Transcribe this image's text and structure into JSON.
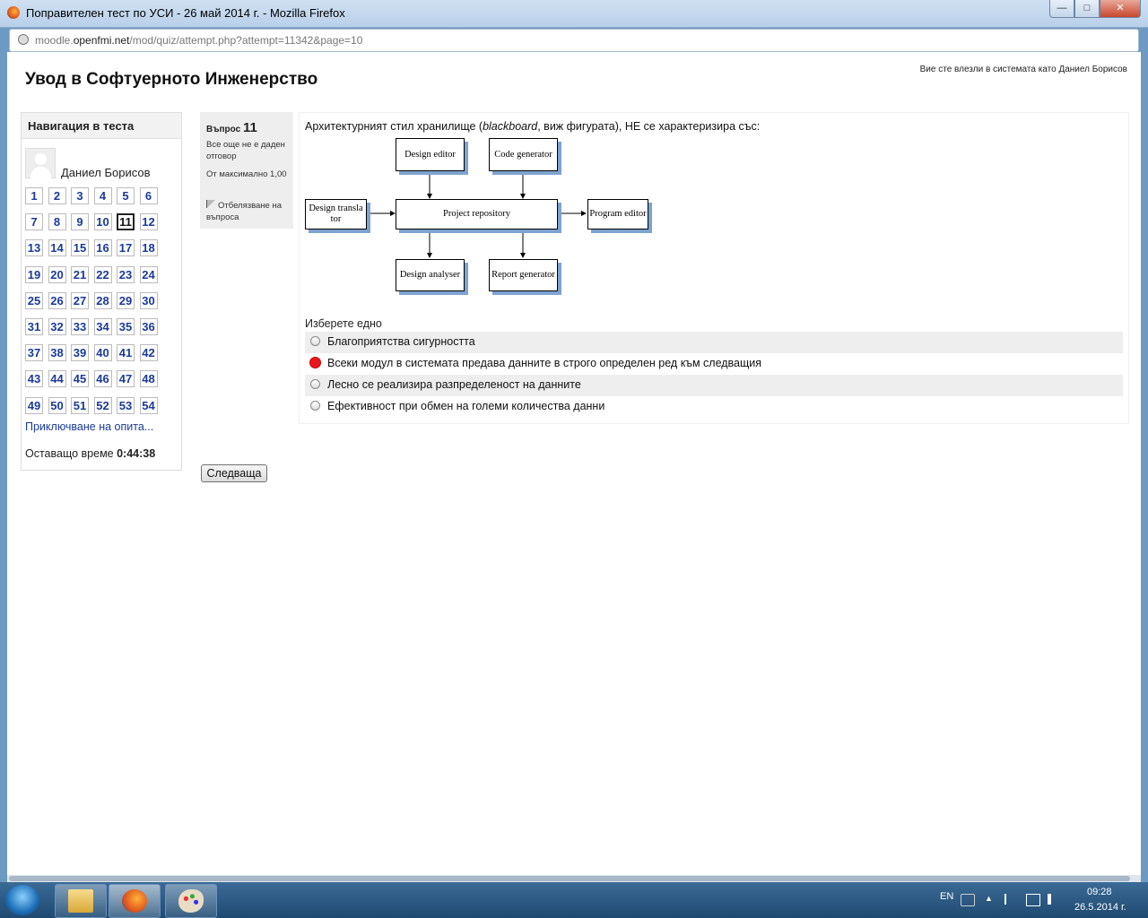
{
  "window": {
    "title": "Поправителен тест по УСИ - 26 май 2014 г. - Mozilla Firefox",
    "url_pre": "moodle.",
    "url_domain": "openfmi.net",
    "url_path": "/mod/quiz/attempt.php?attempt=11342&page=10"
  },
  "header": {
    "site_title": "Увод в Софтуерното Инженерство",
    "login_info": "Вие сте влезли в системата като Даниел Борисов"
  },
  "nav": {
    "title": "Навигация в теста",
    "user": "Даниел Борисов",
    "questions": [
      "1",
      "2",
      "3",
      "4",
      "5",
      "6",
      "7",
      "8",
      "9",
      "10",
      "11",
      "12",
      "13",
      "14",
      "15",
      "16",
      "17",
      "18",
      "19",
      "20",
      "21",
      "22",
      "23",
      "24",
      "25",
      "26",
      "27",
      "28",
      "29",
      "30",
      "31",
      "32",
      "33",
      "34",
      "35",
      "36",
      "37",
      "38",
      "39",
      "40",
      "41",
      "42",
      "43",
      "44",
      "45",
      "46",
      "47",
      "48",
      "49",
      "50",
      "51",
      "52",
      "53",
      "54"
    ],
    "current": "11",
    "finish_link": "Приключване на опита...",
    "timer_label": "Оставащо време",
    "timer_value": "0:44:38"
  },
  "question": {
    "label": "Въпрос",
    "number": "11",
    "state": "Все още не е даден отговор",
    "grade": "От максимално 1,00",
    "flag": "Отбелязване на въпроса",
    "text_before": "Архитектурният стил хранилище (",
    "text_italic": "blackboard",
    "text_after": ", виж фигурата), НЕ се характеризира със:",
    "prompt": "Изберете едно",
    "answers": [
      {
        "label": "Благоприятства сигурността",
        "checked": false
      },
      {
        "label": "Всеки модул в системата предава данните в строго определен ред към следващия",
        "checked": true
      },
      {
        "label": "Лесно се реализира разпределеност на данните",
        "checked": false
      },
      {
        "label": "Ефективност при обмен на големи количества данни",
        "checked": false
      }
    ]
  },
  "diagram": {
    "design_editor": "Design editor",
    "code_generator": "Code generator",
    "design_translator": "Design transla tor",
    "project_repository": "Project repository",
    "program_editor": "Program editor",
    "design_analyser": "Design analyser",
    "report_generator": "Report generator"
  },
  "buttons": {
    "next": "Следваща"
  },
  "taskbar": {
    "lang": "EN",
    "time": "09:28",
    "date": "26.5.2014 г."
  },
  "colors": {
    "accent_link": "#1a3a9a",
    "selected_radio": "#e8161f",
    "box_shadow": "#7ea3d0"
  }
}
